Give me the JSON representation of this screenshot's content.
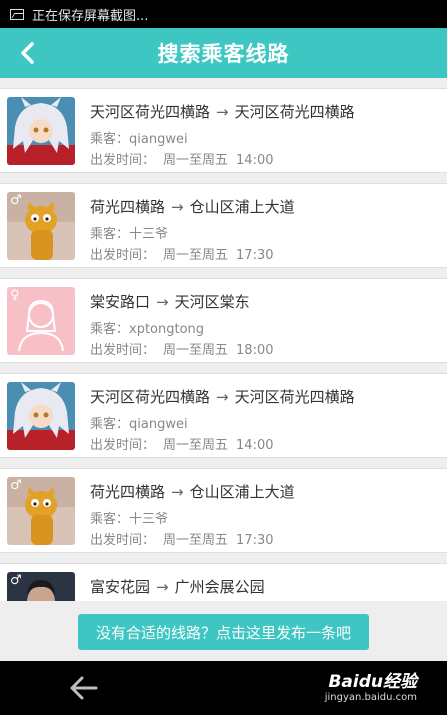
{
  "status_bar": {
    "text": "正在保存屏幕截图..."
  },
  "header": {
    "title": "搜索乘客线路"
  },
  "list": {
    "passenger_label": "乘客：",
    "departure_label": "出发时间：",
    "items": [
      {
        "from": "天河区荷光四横路",
        "to": "天河区荷光四横路",
        "passenger": "qiangwei",
        "days": "周一至周五",
        "time": "14:00",
        "avatar": "anime-character-avatar",
        "gender_icon": ""
      },
      {
        "from": "荷光四横路",
        "to": "仓山区浦上大道",
        "passenger": "十三爷",
        "days": "周一至周五",
        "time": "17:30",
        "avatar": "garfield-avatar",
        "gender_icon": "♂"
      },
      {
        "from": "棠安路口",
        "to": "天河区棠东",
        "passenger": "xptongtong",
        "days": "周一至周五",
        "time": "18:00",
        "avatar": "default-female-avatar",
        "gender_icon": "♀"
      },
      {
        "from": "天河区荷光四横路",
        "to": "天河区荷光四横路",
        "passenger": "qiangwei",
        "days": "周一至周五",
        "time": "14:00",
        "avatar": "anime-character-avatar",
        "gender_icon": ""
      },
      {
        "from": "荷光四横路",
        "to": "仓山区浦上大道",
        "passenger": "十三爷",
        "days": "周一至周五",
        "time": "17:30",
        "avatar": "garfield-avatar",
        "gender_icon": "♂"
      },
      {
        "from": "富安花园",
        "to": "广州会展公园",
        "passenger": "",
        "days": "",
        "time": "",
        "avatar": "man-photo-avatar",
        "gender_icon": "♂"
      }
    ]
  },
  "publish_button": {
    "label": "没有合适的线路？点击这里发布一条吧"
  },
  "watermark": {
    "text": "Baidu经验",
    "url": "jingyan.baidu.com"
  },
  "colors": {
    "accent": "#3ec7c2",
    "status_bar": "#000000",
    "background": "#eeeeee"
  }
}
